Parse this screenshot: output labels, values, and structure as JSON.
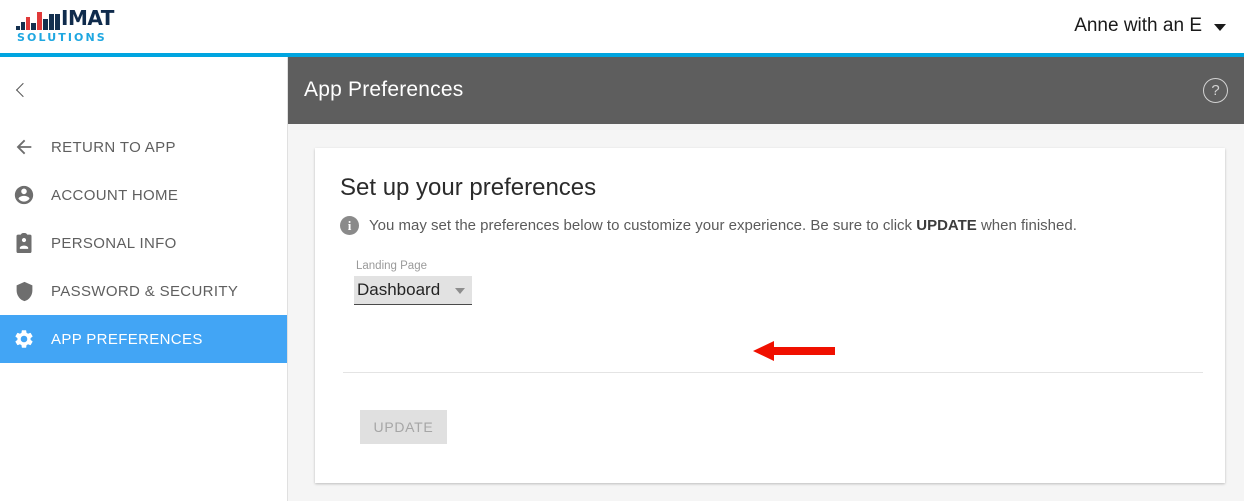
{
  "topbar": {
    "logo": {
      "word": "IMAT",
      "sub": "SOLUTIONS",
      "navy": "#14304f",
      "red": "#e03a3a",
      "cyan": "#1ea7e1"
    },
    "user_name": "Anne with an E",
    "caret_icon": "chevron-down-icon",
    "accent_color": "#00a5e0"
  },
  "sidebar": {
    "collapse_icon": "chevron-left-icon",
    "items": [
      {
        "label": "RETURN TO APP",
        "icon": "arrow-left-icon",
        "active": false
      },
      {
        "label": "ACCOUNT HOME",
        "icon": "account-circle-icon",
        "active": false
      },
      {
        "label": "PERSONAL INFO",
        "icon": "contact-card-icon",
        "active": false
      },
      {
        "label": "PASSWORD & SECURITY",
        "icon": "shield-icon",
        "active": false
      },
      {
        "label": "APP PREFERENCES",
        "icon": "gear-icon",
        "active": true
      }
    ],
    "active_color": "#42a5f5"
  },
  "page": {
    "header": {
      "title": "App Preferences",
      "help_icon": "question-mark-icon",
      "help_label": "?",
      "bar_color": "#5e5e5e"
    },
    "card": {
      "title": "Set up your preferences",
      "info_icon": "info-icon",
      "info_icon_label": "i",
      "info_text_before": "You may set the preferences below to customize your experience. Be sure to click ",
      "info_text_bold": "UPDATE",
      "info_text_after": " when finished.",
      "field": {
        "label": "Landing Page",
        "value": "Dashboard",
        "arrow_icon": "dropdown-caret-icon"
      },
      "update_button": "UPDATE"
    }
  },
  "annotation": {
    "arrow_icon": "red-pointer-arrow-icon",
    "color": "#f01000"
  }
}
